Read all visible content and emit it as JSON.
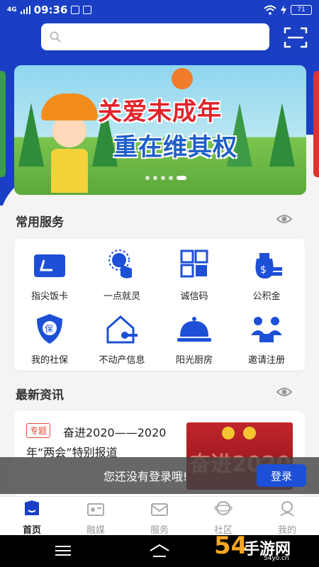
{
  "status_bar": {
    "network": "4G",
    "time": "09:36",
    "battery": "71"
  },
  "search": {
    "placeholder": ""
  },
  "banner": {
    "line1": "关爱未成年",
    "line2": "重在维其权",
    "slide_count": 5,
    "active_slide": 5
  },
  "common_services": {
    "title": "常用服务",
    "items": [
      {
        "label": "指尖饭卡",
        "icon": "card-icon"
      },
      {
        "label": "一点就灵",
        "icon": "tap-icon"
      },
      {
        "label": "诚信码",
        "icon": "qrcode-icon"
      },
      {
        "label": "公积金",
        "icon": "money-bag-icon"
      },
      {
        "label": "我的社保",
        "icon": "shield-icon"
      },
      {
        "label": "不动产信息",
        "icon": "house-key-icon"
      },
      {
        "label": "阳光厨房",
        "icon": "cloche-icon"
      },
      {
        "label": "邀请注册",
        "icon": "people-icon"
      }
    ]
  },
  "news": {
    "title": "最新资讯",
    "item": {
      "tag": "专题",
      "headline": "奋进2020——2020年“两会”特别报道",
      "thumb_big_text": "奋进2020"
    }
  },
  "login_prompt": {
    "message": "您还没有登录哦!",
    "button": "登录"
  },
  "tabs": [
    {
      "label": "首页",
      "active": true
    },
    {
      "label": "融媒",
      "active": false
    },
    {
      "label": "服务",
      "active": false
    },
    {
      "label": "社区",
      "active": false
    },
    {
      "label": "我的",
      "active": false
    }
  ],
  "watermark": {
    "brand": "手游网",
    "number": "54",
    "sub": "54yo.cn"
  },
  "colors": {
    "primary": "#1a3fc4",
    "button": "#1d50d6",
    "tag": "#e64a3c"
  }
}
